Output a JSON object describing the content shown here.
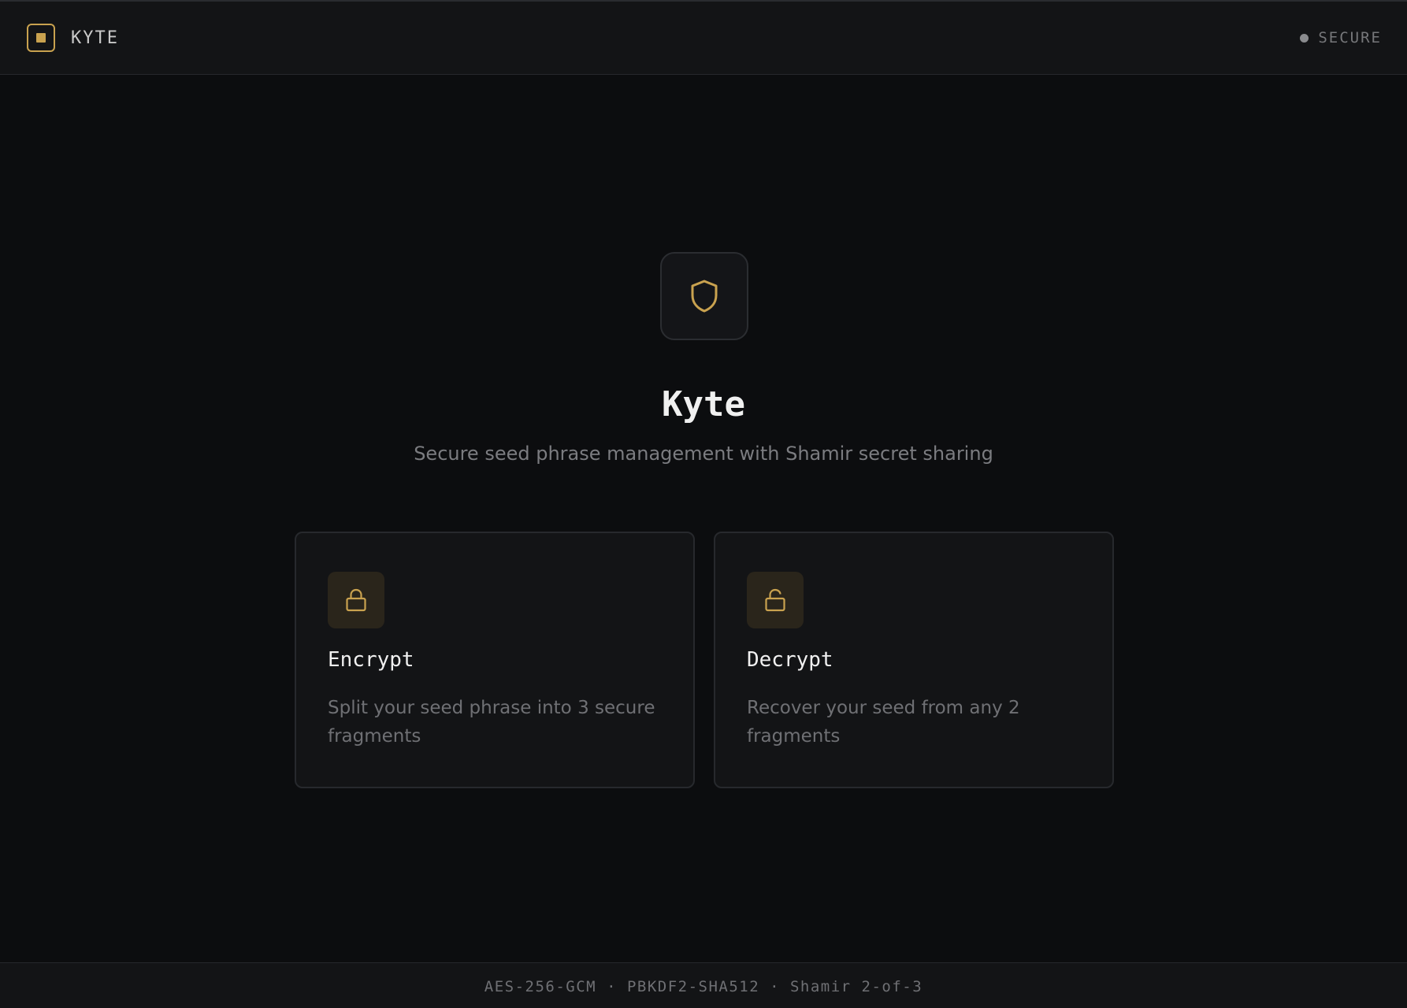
{
  "header": {
    "brand_name": "KYTE",
    "status_label": "SECURE"
  },
  "hero": {
    "icon": "shield-icon",
    "title": "Kyte",
    "subtitle": "Secure seed phrase management with Shamir secret sharing"
  },
  "cards": [
    {
      "icon": "lock-icon",
      "title": "Encrypt",
      "description": "Split your seed phrase into 3 secure fragments"
    },
    {
      "icon": "unlock-icon",
      "title": "Decrypt",
      "description": "Recover your seed from any 2 fragments"
    }
  ],
  "footer": {
    "text": "AES-256-GCM · PBKDF2-SHA512 · Shamir 2-of-3"
  },
  "colors": {
    "accent": "#c9a24f",
    "background": "#0c0d0f",
    "surface": "#131416"
  }
}
